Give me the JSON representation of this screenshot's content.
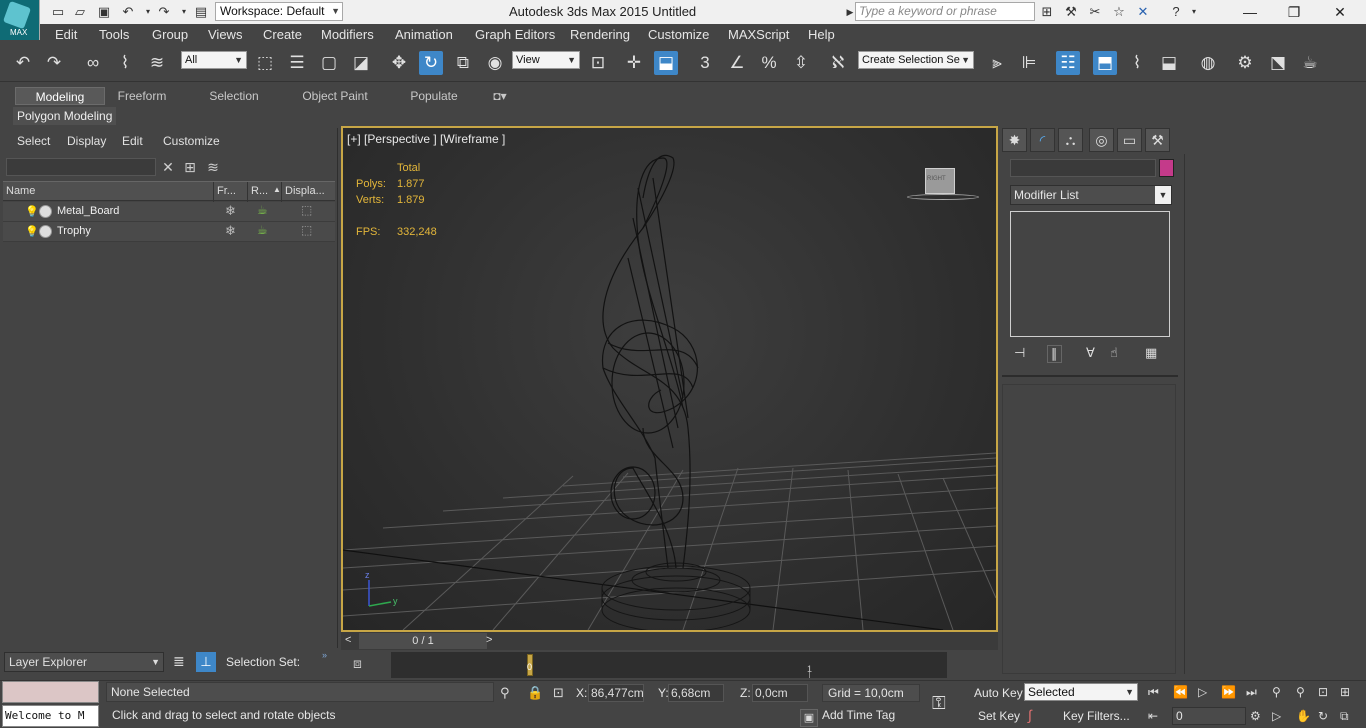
{
  "titlebar": {
    "logo_text": "MAX",
    "workspace": "Workspace: Default",
    "title": "Autodesk 3ds Max  2015     Untitled",
    "search_placeholder": "Type a keyword or phrase"
  },
  "menu": [
    "Edit",
    "Tools",
    "Group",
    "Views",
    "Create",
    "Modifiers",
    "Animation",
    "Graph Editors",
    "Rendering",
    "Customize",
    "MAXScript",
    "Help"
  ],
  "toolbar": {
    "selection_filter": "All",
    "ref_coord": "View",
    "selection_set": "Create Selection Se",
    "snap_label": "3"
  },
  "ribbon": {
    "tabs": [
      "Modeling",
      "Freeform",
      "Selection",
      "Object Paint",
      "Populate"
    ],
    "panel_label": "Polygon Modeling"
  },
  "scene_explorer": {
    "menu": [
      "Select",
      "Display",
      "Edit",
      "Customize"
    ],
    "columns": [
      "Name",
      "Fr...",
      "R...",
      "Displa..."
    ],
    "rows": [
      {
        "name": "Metal_Board"
      },
      {
        "name": "Trophy"
      }
    ],
    "layer_explorer": "Layer Explorer",
    "selection_set_label": "Selection Set:"
  },
  "viewport": {
    "label": "[+] [Perspective ] [Wireframe ]",
    "stats_title": "Total",
    "polys_label": "Polys:",
    "polys_value": "1.877",
    "verts_label": "Verts:",
    "verts_value": "1.879",
    "fps_label": "FPS:",
    "fps_value": "332,248",
    "viewcube_label": "RIGHT",
    "axis_z": "z",
    "axis_y": "y"
  },
  "time_slider": {
    "value": "0 / 1",
    "prev": "<",
    "next": ">",
    "tick_0": "0",
    "tick_1": "1"
  },
  "command_panel": {
    "modifier_list": "Modifier List"
  },
  "statusbar": {
    "maxscript_line": "Welcome to M",
    "selection_info": "None Selected",
    "prompt": "Click and drag to select and rotate objects",
    "x_label": "X:",
    "x_value": "86,477cm",
    "y_label": "Y:",
    "y_value": "6,68cm",
    "z_label": "Z:",
    "z_value": "0,0cm",
    "grid": "Grid = 10,0cm",
    "add_time_tag": "Add Time Tag",
    "auto_key": "Auto Key",
    "set_key": "Set Key",
    "key_mode": "Selected",
    "key_filters": "Key Filters...",
    "frame": "0"
  },
  "colors": {
    "accent": "#3e87c8",
    "viewport_border": "#c7a646",
    "stats": "#e3b63a",
    "object_color": "#c43a8a"
  }
}
